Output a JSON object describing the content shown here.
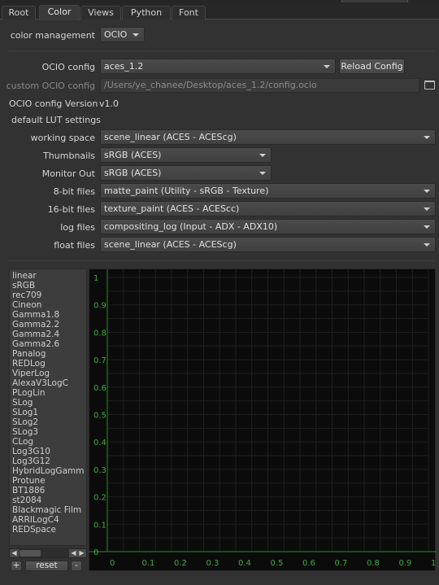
{
  "tabs": [
    {
      "label": "Root",
      "active": false
    },
    {
      "label": "Color",
      "active": true
    },
    {
      "label": "Views",
      "active": false
    },
    {
      "label": "Python",
      "active": false
    },
    {
      "label": "Font",
      "active": false
    }
  ],
  "color_management": {
    "label": "color management",
    "value": "OCIO"
  },
  "ocio_config": {
    "label": "OCIO config",
    "value": "aces_1.2",
    "reload_label": "Reload Config"
  },
  "custom_ocio": {
    "label": "custom OCIO config",
    "path": "/Users/ye_chanee/Desktop/aces_1.2/config.ocio",
    "icon": "folder-icon"
  },
  "ocio_version": {
    "label": "OCIO config Version",
    "value": "v1.0"
  },
  "default_lut": {
    "label": "default LUT settings"
  },
  "lut_rows": {
    "working_space": {
      "label": "working space",
      "value": "scene_linear (ACES - ACEScg)"
    },
    "thumbnails": {
      "label": "Thumbnails",
      "value": "sRGB (ACES)"
    },
    "monitor_out": {
      "label": "Monitor Out",
      "value": "sRGB (ACES)"
    },
    "bit8": {
      "label": "8-bit files",
      "value": "matte_paint (Utility - sRGB - Texture)"
    },
    "bit16": {
      "label": "16-bit files",
      "value": "texture_paint (ACES - ACEScc)"
    },
    "log": {
      "label": "log files",
      "value": "compositing_log (Input - ADX - ADX10)"
    },
    "float": {
      "label": "float files",
      "value": "scene_linear (ACES - ACEScg)"
    }
  },
  "curves": [
    "linear",
    "sRGB",
    "rec709",
    "Cineon",
    "Gamma1.8",
    "Gamma2.2",
    "Gamma2.4",
    "Gamma2.6",
    "Panalog",
    "REDLog",
    "ViperLog",
    "AlexaV3LogC",
    "PLogLin",
    "SLog",
    "SLog1",
    "SLog2",
    "SLog3",
    "CLog",
    "Log3G10",
    "Log3G12",
    "HybridLogGamm",
    "Protune",
    "BT1886",
    "st2084",
    "Blackmagic Film",
    "ARRILogC4",
    "REDSpace"
  ],
  "curve_buttons": {
    "add": "+",
    "reset": "reset",
    "remove": "-"
  },
  "graph": {
    "y_ticks": [
      "1",
      "0.9",
      "0.8",
      "0.7",
      "0.6",
      "0.5",
      "0.4",
      "0.3",
      "0.2",
      "0.1",
      "0"
    ],
    "x_ticks": [
      "0",
      "0.1",
      "0.2",
      "0.3",
      "0.4",
      "0.5",
      "0.6",
      "0.7",
      "0.8",
      "0.9",
      "1"
    ],
    "label_color": "#3fae3f",
    "axis_color": "#2f8a2f",
    "grid_color": "#1f1f1f"
  }
}
